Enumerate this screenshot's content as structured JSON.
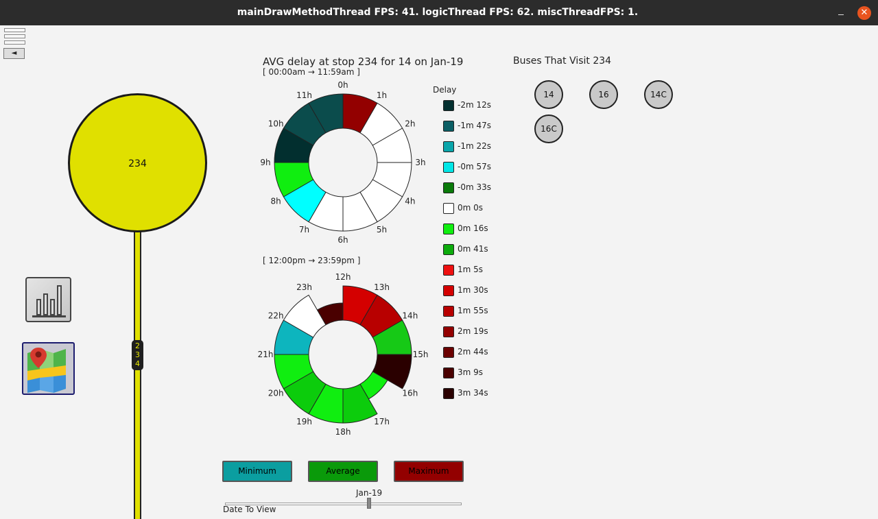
{
  "window": {
    "title": "mainDrawMethodThread FPS: 41. logicThread FPS: 62. miscThreadFPS: 1.",
    "minimize_label": "–",
    "close_label": "✕"
  },
  "sidebar": {
    "collapse_label": "◄",
    "stop_name": "234",
    "stop_marker": "2\n3\n4",
    "chart_icon": "bar-chart-icon",
    "map_icon": "map-pin-icon"
  },
  "panel": {
    "title": "AVG delay at stop 234 for 14 on Jan-19",
    "am_range": "[ 00:00am → 11:59am ]",
    "pm_range": "[ 12:00pm → 23:59pm ]",
    "legend_title": "Delay"
  },
  "chart_data": [
    {
      "type": "polar",
      "title": "AVG delay at stop 234 for 14 on Jan-19",
      "subtitle": "[ 00:00am → 11:59am ]",
      "categories": [
        "0h",
        "1h",
        "2h",
        "3h",
        "4h",
        "5h",
        "6h",
        "7h",
        "8h",
        "9h",
        "10h",
        "11h"
      ],
      "delay_labels": [
        "0m 0s",
        "0m 0s",
        "0m 0s",
        "0m 0s",
        "0m 0s",
        "0m 0s",
        "0m 0s",
        "-0m 57s",
        "0m 16s",
        "-2m 12s",
        "-2m 12s",
        "-1m 47s"
      ],
      "colors": [
        "#930000",
        "#ffffff",
        "#ffffff",
        "#ffffff",
        "#ffffff",
        "#ffffff",
        "#ffffff",
        "#00ffff",
        "#10ee10",
        "#022f2f",
        "#0b4c4c",
        "#0b4c4c"
      ],
      "magnitude": [
        1,
        1,
        1,
        1,
        1,
        1,
        1,
        1,
        1,
        1,
        1,
        1
      ]
    },
    {
      "type": "polar",
      "subtitle": "[ 12:00pm → 23:59pm ]",
      "categories": [
        "12h",
        "13h",
        "14h",
        "15h",
        "16h",
        "17h",
        "18h",
        "19h",
        "20h",
        "21h",
        "22h",
        "23h"
      ],
      "delay_labels": [
        "1m 30s",
        "1m 55s",
        "0m 41s",
        "3m 34s",
        "0m 16s",
        "0m 41s",
        "0m 16s",
        "0m 41s",
        "0m 16s",
        "-1m 22s",
        "0m 0s",
        "2m 44s"
      ],
      "colors": [
        "#d40000",
        "#b80000",
        "#16c916",
        "#2a0000",
        "#10ee10",
        "#0ccc0c",
        "#10ee10",
        "#0ccc0c",
        "#10ee10",
        "#0db5be",
        "#ffffff",
        "#4a0000"
      ],
      "magnitude": [
        1,
        1,
        1,
        1,
        0.5,
        1,
        1,
        1,
        1,
        1,
        1,
        0.5
      ]
    }
  ],
  "legend": [
    {
      "label": "-2m 12s",
      "color": "#022f2f"
    },
    {
      "label": "-1m 47s",
      "color": "#0b5e64"
    },
    {
      "label": "-1m 22s",
      "color": "#0aa5aa"
    },
    {
      "label": "-0m 57s",
      "color": "#00e6e6"
    },
    {
      "label": "-0m 33s",
      "color": "#0a7a0a"
    },
    {
      "label": "0m 0s",
      "color": "#ffffff"
    },
    {
      "label": "0m 16s",
      "color": "#10ee10"
    },
    {
      "label": "0m 41s",
      "color": "#0cab0c"
    },
    {
      "label": "1m 5s",
      "color": "#ee1010"
    },
    {
      "label": "1m 30s",
      "color": "#d40000"
    },
    {
      "label": "1m 55s",
      "color": "#b80000"
    },
    {
      "label": "2m 19s",
      "color": "#930000"
    },
    {
      "label": "2m 44s",
      "color": "#6b0000"
    },
    {
      "label": "3m 9s",
      "color": "#4a0000"
    },
    {
      "label": "3m 34s",
      "color": "#2a0000"
    }
  ],
  "buses": {
    "title": "Buses That Visit 234",
    "routes": [
      "14",
      "16",
      "14C",
      "16C"
    ]
  },
  "controls": {
    "minimum_label": "Minimum",
    "average_label": "Average",
    "maximum_label": "Maximum",
    "minimum_color": "#0b9ea0",
    "average_color": "#0a9a0a",
    "maximum_color": "#930000",
    "date_value": "Jan-19",
    "date_label": "Date To View",
    "slider_fraction": 0.61
  }
}
